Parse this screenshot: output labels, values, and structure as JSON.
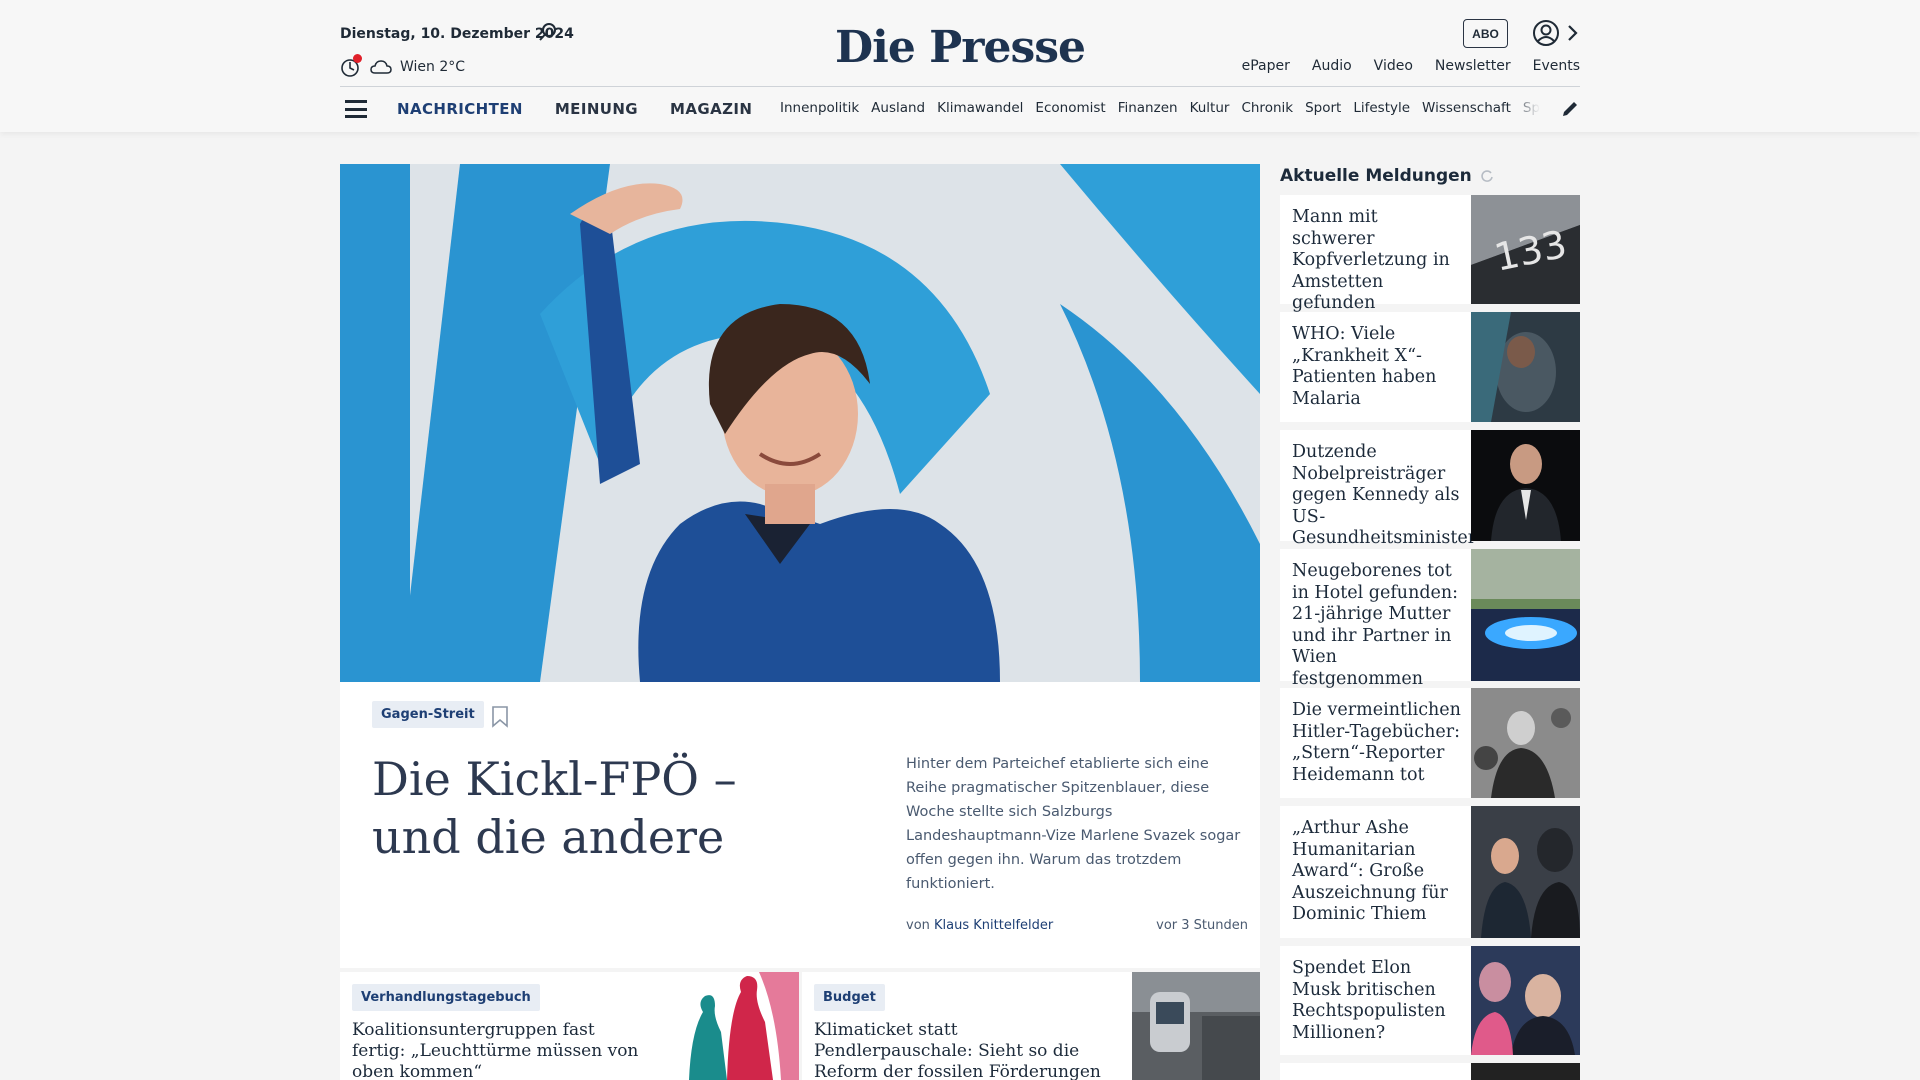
{
  "header": {
    "date": "Dienstag, 10. Dezember 2024",
    "weather": "Wien 2°C",
    "logo": "Die Presse",
    "abo_label": "ABO",
    "top_links": [
      "ePaper",
      "Audio",
      "Video",
      "Newsletter",
      "Events"
    ],
    "main_nav": [
      "NACHRICHTEN",
      "MEINUNG",
      "MAGAZIN"
    ],
    "sub_nav": [
      "Innenpolitik",
      "Ausland",
      "Klimawandel",
      "Economist",
      "Finanzen",
      "Kultur",
      "Chronik",
      "Sport",
      "Lifestyle",
      "Wissenschaft",
      "Spectrum"
    ]
  },
  "hero": {
    "tag": "Gagen-Streit",
    "title": "Die Kickl-FPÖ – und die andere",
    "teaser": "Hinter dem Parteichef etablierte sich eine Reihe pragmatischer Spitzenblauer, diese Woche stellte sich Salzburgs Landeshauptmann-Vize Marlene Svazek sogar offen gegen ihn. Warum das trotzdem funktioniert.",
    "byline_prefix": "von",
    "author": "Klaus Knittelfelder",
    "time": "vor 3 Stunden"
  },
  "cards": [
    {
      "tag": "Verhandlungstagebuch",
      "title": "Koalitionsuntergruppen fast fertig: „Leuchttürme müssen von oben kommen“"
    },
    {
      "tag": "Budget",
      "title": "Klimaticket statt Pendlerpauschale: Sieht so die Reform der fossilen Förderungen aus?"
    }
  ],
  "sidebar": {
    "heading": "Aktuelle Meldungen",
    "items": [
      {
        "title": "Mann mit schwerer Kopfverletzung in Amstetten gefunden",
        "thumb_text": "133"
      },
      {
        "title": "WHO: Viele „Krankheit X“-Patienten haben Malaria"
      },
      {
        "title": "Dutzende Nobelpreisträger gegen Kennedy als US-Gesundheitsminister"
      },
      {
        "title": "Neugeborenes tot in Hotel gefunden: 21-jährige Mutter und ihr Partner in Wien festgenommen"
      },
      {
        "title": "Die vermeintlichen Hitler-Tagebücher: „Stern“-Reporter Heidemann tot"
      },
      {
        "title": "„Arthur Ashe Humanitarian Award“: Große Auszeichnung für Dominic Thiem"
      },
      {
        "title": "Spendet Elon Musk britischen Rechtspopulisten Millionen?"
      }
    ]
  },
  "colors": {
    "brand": "#1e3350",
    "link": "#1e3f74",
    "alert_dot": "#e0202a",
    "tag_bg": "#e8edf4"
  }
}
